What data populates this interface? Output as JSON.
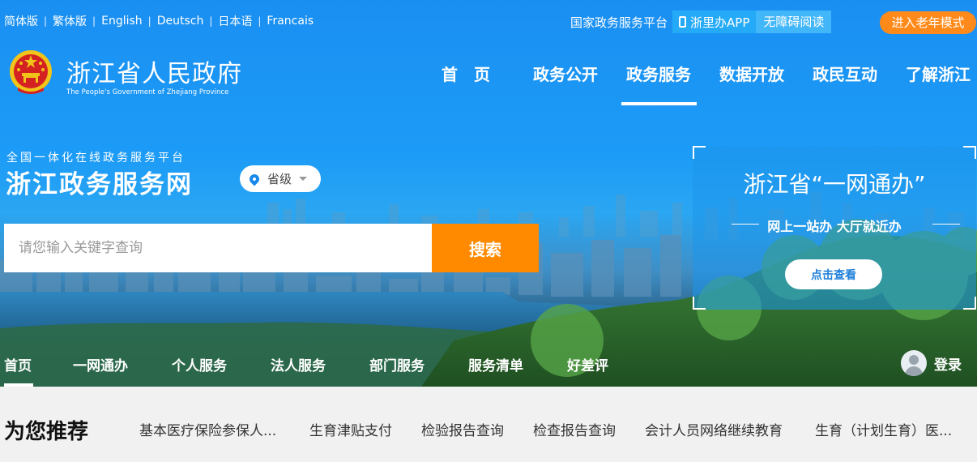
{
  "lang_bar": [
    "简体版",
    "繁体版",
    "English",
    "Deutsch",
    "日本语",
    "Francais"
  ],
  "utilities": {
    "platform": "国家政务服务平台",
    "app": "浙里办APP",
    "accessibility": "无障碍阅读",
    "elder_mode": "进入老年模式"
  },
  "logo": {
    "title": "浙江省人民政府",
    "subtitle": "The People's Government of Zhejiang Province"
  },
  "main_nav": {
    "items": [
      "首　页",
      "政务公开",
      "政务服务",
      "数据开放",
      "政民互动",
      "了解浙江"
    ],
    "active": "政务服务"
  },
  "platform": {
    "subtitle": "全国一体化在线政务服务平台",
    "title": "浙江政务服务网",
    "region": "省级"
  },
  "search": {
    "placeholder": "请您输入关键字查询",
    "button": "搜索"
  },
  "one_net": {
    "title": "浙江省“一网通办”",
    "slogan": "网上一站办 大厅就近办",
    "button": "点击查看"
  },
  "sub_nav": {
    "items": [
      "首页",
      "一网通办",
      "个人服务",
      "法人服务",
      "部门服务",
      "服务清单",
      "好差评"
    ],
    "active": "首页",
    "login": "登录"
  },
  "recommend": {
    "title": "为您推荐",
    "items": [
      "基本医疗保险参保人...",
      "生育津贴支付",
      "检验报告查询",
      "检查报告查询",
      "会计人员网络继续教育",
      "生育（计划生育）医..."
    ]
  },
  "colors": {
    "primary_blue": "#1a8ff2",
    "accent_orange": "#ff8a00",
    "elder_orange": "#ff8a19"
  }
}
